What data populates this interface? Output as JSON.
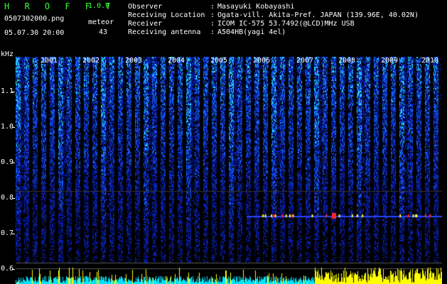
{
  "header": {
    "title": "H R O F F T",
    "version": "1.0.0",
    "filename": "0507302000.png",
    "datetime": "05.07.30 20:00",
    "meteor_label": "meteor",
    "meteor_count": "43"
  },
  "info": [
    {
      "key": "Observer",
      "value": "Masayuki Kobayashi"
    },
    {
      "key": "Receiving Location",
      "value": "Ogata-vill. Akita-Pref. JAPAN (139.96E, 40.02N)"
    },
    {
      "key": "Receiver",
      "value": "ICOM IC-575 53.7492(@LCD)MHz USB"
    },
    {
      "key": "Receiving antenna",
      "value": "A504HB(yagi 4el)"
    }
  ],
  "axis": {
    "unit": "kHz",
    "y_ticks": [
      "1.1",
      "1.0",
      "0.9",
      "0.8",
      "0.7",
      "0.6"
    ],
    "x_ticks": [
      "2001",
      "2002",
      "2003",
      "2004",
      "2005",
      "2006",
      "2007",
      "2008",
      "2009",
      "2010"
    ]
  },
  "colors": {
    "background": "#000000",
    "title_green": "#39ff39",
    "echo_yellow": "#ffff00",
    "echo_cyan": "#00e5ff",
    "spectrum_blue": "#1a3cff",
    "beacon_red": "#ff2a2a"
  }
}
